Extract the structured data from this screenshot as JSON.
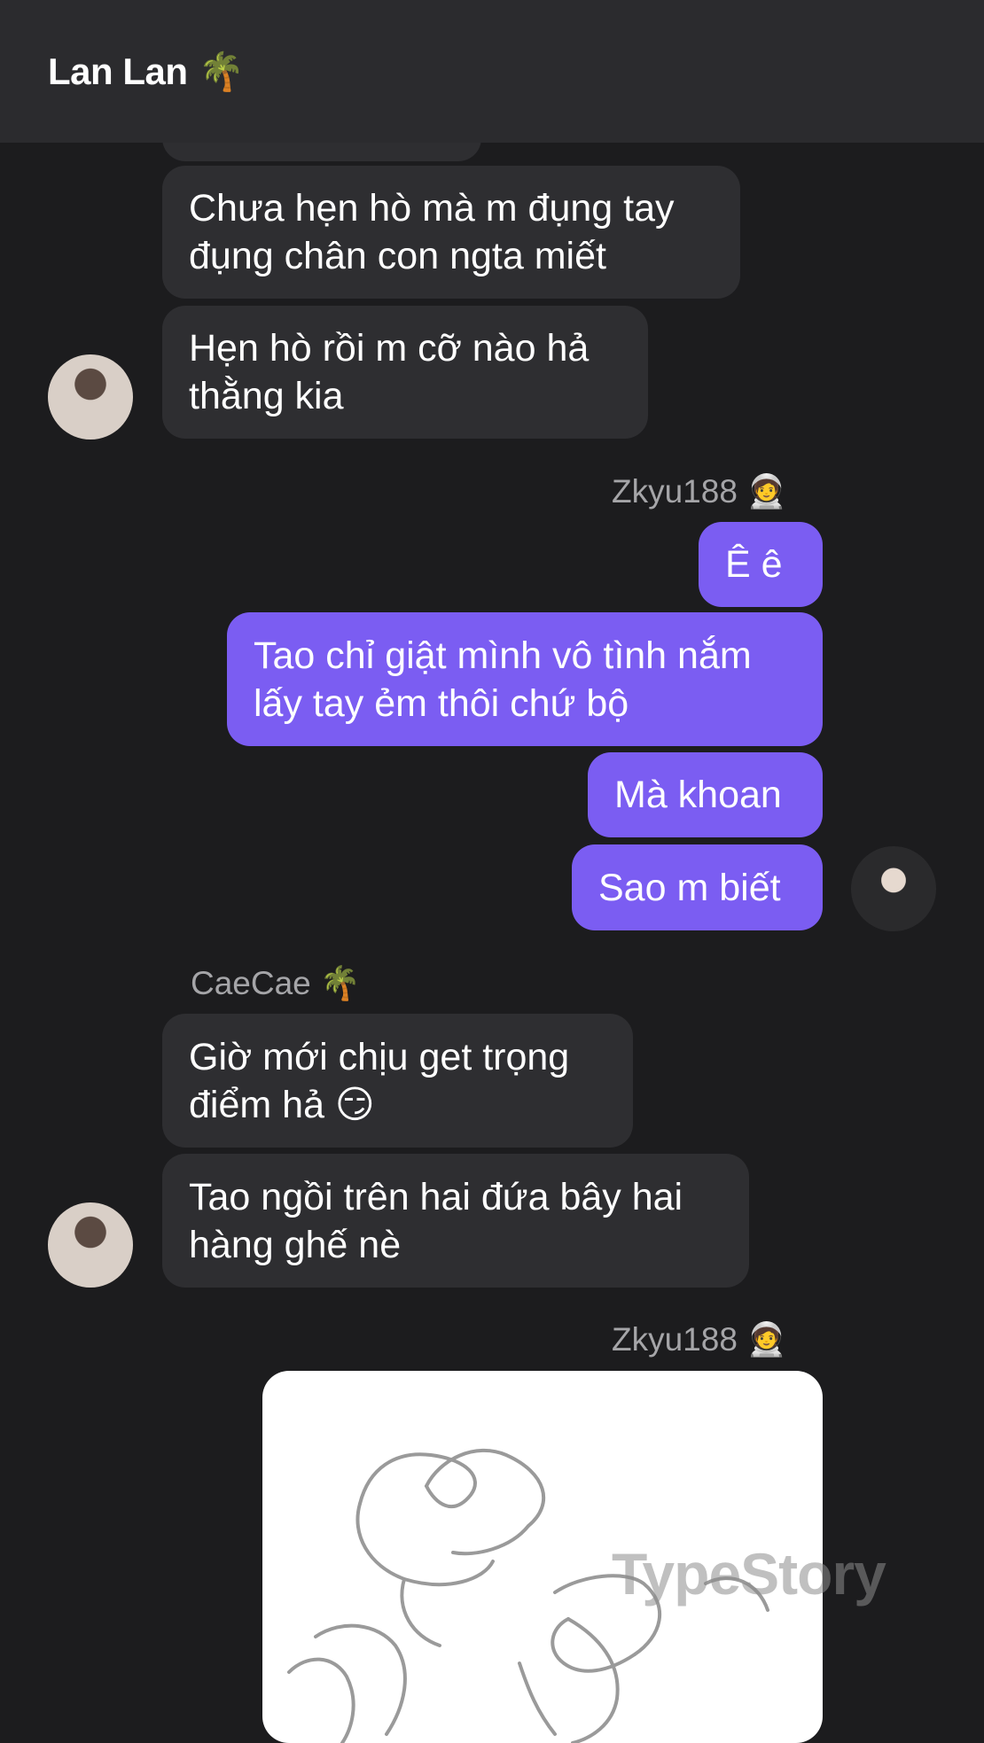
{
  "header": {
    "title": "Lan Lan",
    "title_emoji": "🌴"
  },
  "messages": {
    "m1": "Chưa hẹn hò mà m đụng tay đụng chân con ngta miết",
    "m2": "Hẹn hò rồi m cỡ nào hả thằng kia",
    "m3": "Ê ê",
    "m4": "Tao chỉ giật mình vô tình nắm lấy tay ẻm thôi chứ bộ",
    "m5": "Mà khoan",
    "m6": "Sao m biết",
    "m7": "Giờ mới chịu get trọng điểm hả 😏",
    "m8": "Tao ngồi trên hai đứa bây hai hàng ghế nè"
  },
  "senders": {
    "zkyu_1": {
      "name": "Zkyu188",
      "emoji": "🧑‍🚀"
    },
    "caecae": {
      "name": "CaeCae",
      "emoji": "🌴"
    },
    "zkyu_2": {
      "name": "Zkyu188",
      "emoji": "🧑‍🚀"
    }
  },
  "watermark": "TypeStory",
  "colors": {
    "background": "#1c1c1e",
    "header": "#2b2b2e",
    "incoming_bubble": "#2e2e31",
    "outgoing_bubble": "#7b5df2",
    "sender_text": "#a5a5a8"
  }
}
